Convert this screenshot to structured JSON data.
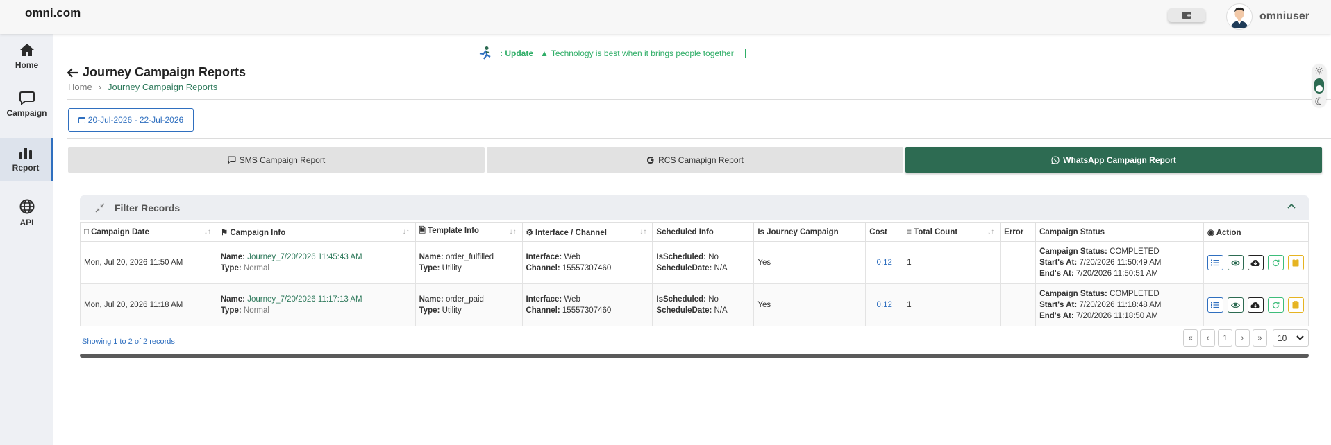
{
  "header": {
    "brand": "omni.com",
    "username": "omniuser",
    "wallet_icon": "wallet-icon"
  },
  "sidebar": {
    "items": [
      {
        "label": "Home",
        "icon": "home-icon",
        "active": false
      },
      {
        "label": "Campaign",
        "icon": "chat-bubble-icon",
        "active": false
      },
      {
        "label": "Report",
        "icon": "bar-chart-icon",
        "active": true
      },
      {
        "label": "API",
        "icon": "globe-icon",
        "active": false
      }
    ]
  },
  "ticker": {
    "update": ": Update",
    "message": "Technology is best when it brings people together"
  },
  "page": {
    "title": "Journey Campaign Reports",
    "breadcrumb_home": "Home",
    "breadcrumb_current": "Journey Campaign Reports",
    "date_range": "20-Jul-2026 - 22-Jul-2026"
  },
  "tabs": [
    {
      "label": "SMS Campaign Report",
      "icon": "chat-bubble-icon",
      "active": false
    },
    {
      "label": "RCS Camapign Report",
      "icon": "google-icon",
      "active": false
    },
    {
      "label": "WhatsApp Campaign Report",
      "icon": "whatsapp-icon",
      "active": true
    }
  ],
  "filter": {
    "title": "Filter Records"
  },
  "table": {
    "headers": {
      "campaign_date": "Campaign Date",
      "campaign_info": "Campaign Info",
      "template_info": "Template Info",
      "interface_channel": "Interface / Channel",
      "scheduled_info": "Scheduled Info",
      "is_journey": "Is Journey Campaign",
      "cost": "Cost",
      "total_count": "Total Count",
      "error": "Error",
      "campaign_status": "Campaign Status",
      "action": "Action"
    },
    "labels": {
      "name": "Name:",
      "type": "Type:",
      "interface": "Interface:",
      "channel": "Channel:",
      "is_scheduled": "IsScheduled:",
      "schedule_date": "ScheduleDate:",
      "campaign_status": "Campaign Status:",
      "starts_at": "Start's At:",
      "ends_at": "End's At:"
    },
    "rows": [
      {
        "campaign_date": "Mon, Jul 20, 2026 11:50 AM",
        "campaign_name": "Journey_7/20/2026 11:45:43 AM",
        "campaign_type": "Normal",
        "template_name": "order_fulfilled",
        "template_type": "Utility",
        "interface": "Web",
        "channel": "15557307460",
        "is_scheduled": "No",
        "schedule_date": "N/A",
        "is_journey": "Yes",
        "cost": "0.12",
        "total_count": "1",
        "error": "",
        "status": "COMPLETED",
        "starts_at": "7/20/2026 11:50:49 AM",
        "ends_at": "7/20/2026 11:50:51 AM"
      },
      {
        "campaign_date": "Mon, Jul 20, 2026 11:18 AM",
        "campaign_name": "Journey_7/20/2026 11:17:13 AM",
        "campaign_type": "Normal",
        "template_name": "order_paid",
        "template_type": "Utility",
        "interface": "Web",
        "channel": "15557307460",
        "is_scheduled": "No",
        "schedule_date": "N/A",
        "is_journey": "Yes",
        "cost": "0.12",
        "total_count": "1",
        "error": "",
        "status": "COMPLETED",
        "starts_at": "7/20/2026 11:18:48 AM",
        "ends_at": "7/20/2026 11:18:50 AM"
      }
    ]
  },
  "pagination": {
    "showing": "Showing 1 to 2 of 2 records",
    "first": "«",
    "prev": "‹",
    "current": "1",
    "next": "›",
    "last": "»",
    "per_page": "10"
  },
  "colors": {
    "accent_green": "#2d6b52",
    "link_blue": "#2f6fbf",
    "ticker_green": "#2fae67"
  }
}
